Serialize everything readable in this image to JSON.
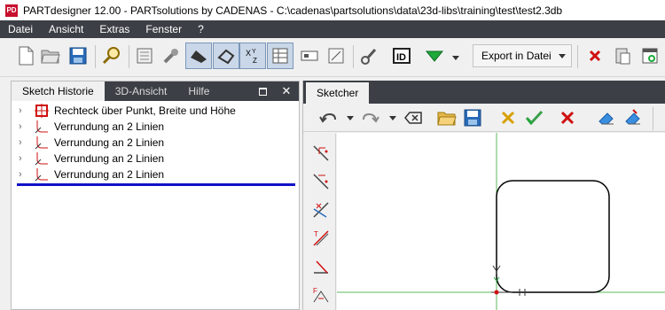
{
  "window": {
    "title": "PARTdesigner 12.00 - PARTsolutions by CADENAS - C:\\cadenas\\partsolutions\\data\\23d-libs\\training\\test\\test2.3db",
    "icon": "partdesigner-app-icon"
  },
  "menu": [
    "Datei",
    "Ansicht",
    "Extras",
    "Fenster",
    "?"
  ],
  "toolbar": {
    "export_label": "Export in Datei",
    "icons": [
      "new-file-icon",
      "open-folder-icon",
      "save-icon",
      "search-icon",
      "document-icon",
      "wrench-icon",
      "edge-tool-icon",
      "shape-tool-icon",
      "xyz-icon",
      "table-icon",
      "form-icon",
      "dimension-icon",
      "pipe-icon",
      "id-icon",
      "triangle-down-icon",
      "delete-icon",
      "paste-icon",
      "window-icon"
    ]
  },
  "left_panel": {
    "tabs": [
      "Sketch Historie",
      "3D-Ansicht",
      "Hilfe"
    ],
    "active_tab": "Sketch Historie",
    "tree": [
      {
        "label": "Rechteck über Punkt, Breite und Höhe",
        "icon": "rectangle-icon"
      },
      {
        "label": "Verrundung an 2 Linien",
        "icon": "fillet-icon"
      },
      {
        "label": "Verrundung an 2 Linien",
        "icon": "fillet-icon"
      },
      {
        "label": "Verrundung an 2 Linien",
        "icon": "fillet-icon"
      },
      {
        "label": "Verrundung an 2 Linien",
        "icon": "fillet-icon"
      }
    ]
  },
  "right_panel": {
    "tab": "Sketcher",
    "sketch_toolbar": [
      "undo-icon",
      "redo-icon",
      "backspace-icon",
      "open-folder-icon",
      "save-icon",
      "cross-check-icon",
      "accept-icon",
      "delete-icon",
      "eraser-icon",
      "eraser-color-icon"
    ],
    "side_tools": [
      "constraint-point-icon",
      "constraint-line-icon",
      "intersect-icon",
      "tangent-icon",
      "perpendicular-icon",
      "fixed-icon"
    ]
  },
  "colors": {
    "menubar_bg": "#3c4046",
    "accent_blue": "#1010c8",
    "axis_green": "#5cb85c",
    "delete_red": "#d01010"
  }
}
